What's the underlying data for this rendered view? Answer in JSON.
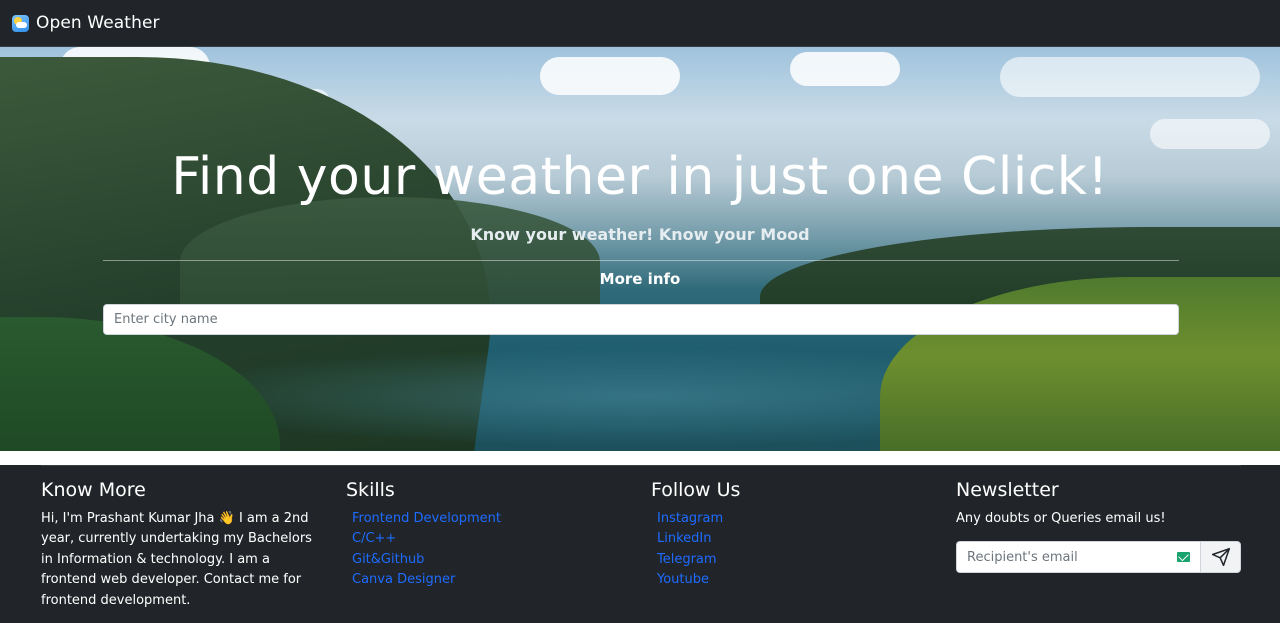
{
  "navbar": {
    "brand": "Open Weather",
    "logo_icon": "weather-cloud-sun-icon"
  },
  "hero": {
    "title": "Find your weather in just one Click!",
    "subtitle": "Know your weather! Know your Mood",
    "more_info": "More info",
    "search_placeholder": "Enter city name"
  },
  "footer": {
    "know_more": {
      "heading": "Know More",
      "text": "Hi, I'm Prashant Kumar Jha 👋 I am a 2nd year, currently undertaking my Bachelors in Information & technology. I am a frontend web developer. Contact me for frontend development."
    },
    "skills": {
      "heading": "Skills",
      "items": [
        "Frontend Development",
        "C/C++",
        "Git&Github",
        "Canva Designer"
      ]
    },
    "follow": {
      "heading": "Follow Us",
      "items": [
        "Instagram",
        "LinkedIn",
        "Telegram",
        "Youtube"
      ]
    },
    "newsletter": {
      "heading": "Newsletter",
      "text": "Any doubts or Queries email us!",
      "placeholder": "Recipient's email",
      "mail_icon": "mail-icon",
      "send_icon": "paper-plane-icon"
    }
  },
  "colors": {
    "dark_bg": "#212529",
    "link": "#1e6bff"
  }
}
